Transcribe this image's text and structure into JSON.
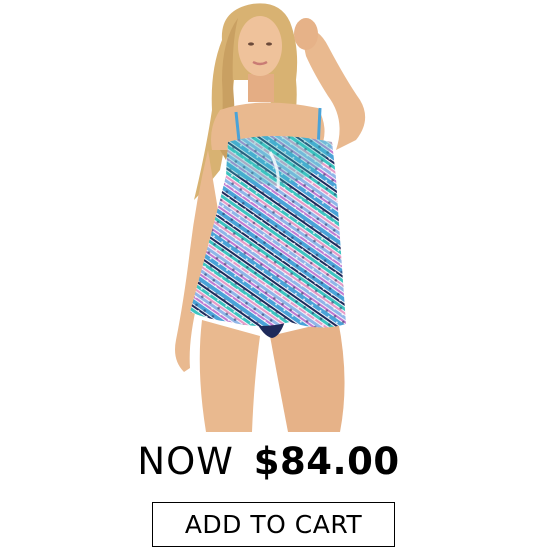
{
  "product": {
    "image_alt": "Model wearing a multicolor striped bandeau tankini swimsuit",
    "price_label": "NOW",
    "price_value": "$84.00",
    "cta_label": "ADD TO CART"
  },
  "colors": {
    "background": "#ffffff",
    "text": "#000000",
    "button_border": "#000000",
    "swim_blue": "#4aa3d8",
    "swim_teal": "#3cc4c0",
    "swim_pink": "#e79ac6",
    "swim_navy": "#1e2a5a",
    "skin": "#e9b98f",
    "hair": "#d8b272"
  }
}
